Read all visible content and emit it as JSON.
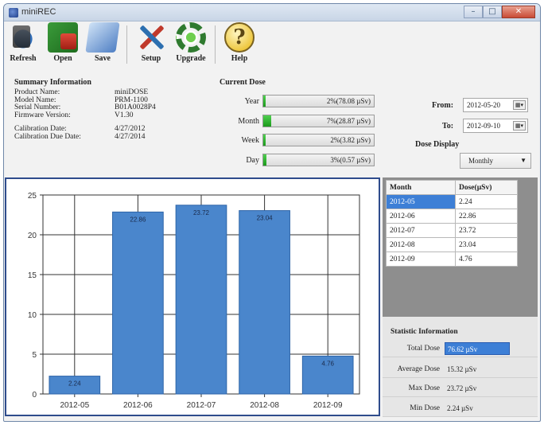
{
  "window": {
    "title": "miniREC"
  },
  "toolbar": {
    "items": [
      {
        "label": "Refresh",
        "icon": "refresh-icon"
      },
      {
        "label": "Open",
        "icon": "open-icon"
      },
      {
        "label": "Save",
        "icon": "save-icon"
      },
      {
        "label": "Setup",
        "icon": "setup-icon"
      },
      {
        "label": "Upgrade",
        "icon": "upgrade-icon"
      },
      {
        "label": "Help",
        "icon": "help-icon"
      }
    ]
  },
  "summary": {
    "title": "Summary Information",
    "rows": [
      {
        "k": "Product Name:",
        "v": "miniDOSE"
      },
      {
        "k": "Model Name:",
        "v": "PRM-1100"
      },
      {
        "k": "Serial Number:",
        "v": "B01A0028P4"
      },
      {
        "k": "Firmware Version:",
        "v": "V1.30"
      },
      {
        "k": "Calibration Date:",
        "v": "4/27/2012"
      },
      {
        "k": "Calibration Due Date:",
        "v": "4/27/2014"
      }
    ]
  },
  "current_dose": {
    "title": "Current Dose",
    "rows": [
      {
        "k": "Year",
        "text": "2%(78.08 µSv)",
        "fill_pct": 2
      },
      {
        "k": "Month",
        "text": "7%(28.87 µSv)",
        "fill_pct": 7
      },
      {
        "k": "Week",
        "text": "2%(3.82 µSv)",
        "fill_pct": 2
      },
      {
        "k": "Day",
        "text": "3%(0.57 µSv)",
        "fill_pct": 3
      }
    ]
  },
  "period": {
    "from_label": "From:",
    "from_value": "2012-05-20",
    "to_label": "To:",
    "to_value": "2012-09-10",
    "display_label": "Dose Display",
    "display_value": "Monthly"
  },
  "table": {
    "headers": [
      "Month",
      "Dose(µSv)"
    ],
    "rows": [
      [
        "2012-05",
        "2.24"
      ],
      [
        "2012-06",
        "22.86"
      ],
      [
        "2012-07",
        "23.72"
      ],
      [
        "2012-08",
        "23.04"
      ],
      [
        "2012-09",
        "4.76"
      ]
    ]
  },
  "statistics": {
    "title": "Statistic Information",
    "rows": [
      {
        "k": "Total Dose",
        "v": "76.62 µSv"
      },
      {
        "k": "Average Dose",
        "v": "15.32 µSv"
      },
      {
        "k": "Max Dose",
        "v": "23.72 µSv"
      },
      {
        "k": "Min Dose",
        "v": "2.24 µSv"
      }
    ]
  },
  "chart_data": {
    "type": "bar",
    "categories": [
      "2012-05",
      "2012-06",
      "2012-07",
      "2012-08",
      "2012-09"
    ],
    "values": [
      2.24,
      22.86,
      23.72,
      23.04,
      4.76
    ],
    "data_labels": [
      "2.24",
      "22.86",
      "23.72",
      "23.04",
      "4.76"
    ],
    "yticks": [
      0,
      5,
      10,
      15,
      20,
      25
    ],
    "ylim": [
      0,
      25
    ],
    "grid": true,
    "colors": {
      "bar": "#4a86cc",
      "bar_edge": "#2d64a8",
      "grid": "#333333"
    }
  }
}
